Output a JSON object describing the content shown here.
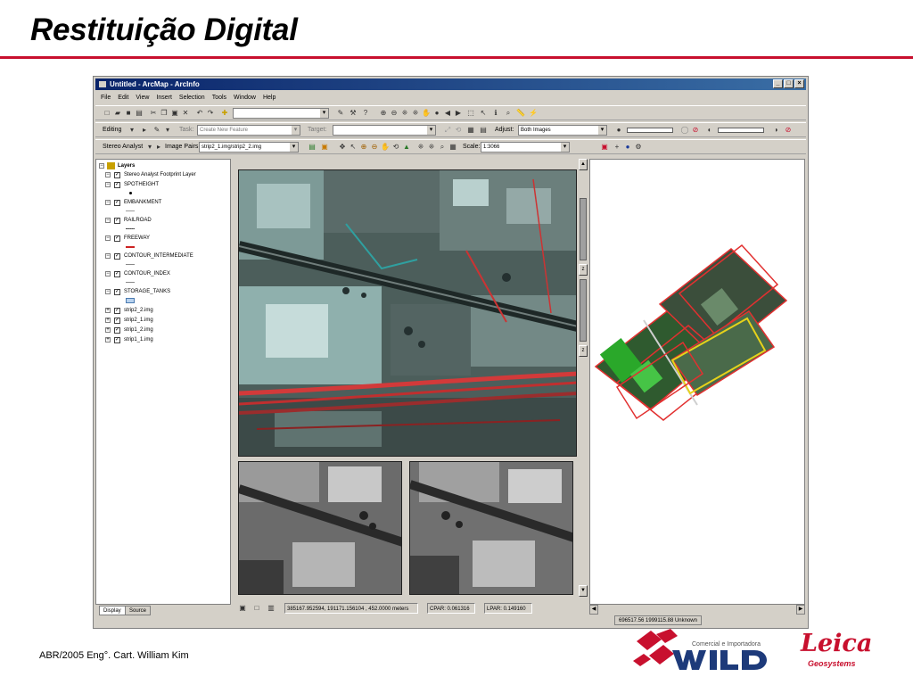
{
  "slide": {
    "title": "Restituição Digital",
    "footer": "ABR/2005 Eng°. Cart. William Kim"
  },
  "app": {
    "window_title": "Untitled - ArcMap - ArcInfo",
    "menu": [
      "File",
      "Edit",
      "View",
      "Insert",
      "Selection",
      "Tools",
      "Window",
      "Help"
    ],
    "toolbar2": {
      "editing_label": "Editing",
      "task_label": "Task:",
      "task_value": "Create New Feature",
      "target_label": "Target:",
      "target_value": "",
      "adjust_label": "Adjust:",
      "adjust_value": "Both Images"
    },
    "toolbar3": {
      "stereo_label": "Stereo Analyst",
      "image_pairs_label": "Image Pairs:",
      "image_pairs_value": "strip2_1.img/strip2_2.img",
      "scale_label": "Scale:",
      "scale_value": "1:3066"
    },
    "toc": {
      "root": "Layers",
      "layers": [
        {
          "name": "Stereo Analyst Footprint Layer",
          "symbol": "none"
        },
        {
          "name": "SPOTHEIGHT",
          "symbol": "point",
          "color": "#000000"
        },
        {
          "name": "EMBANKMENT",
          "symbol": "line",
          "color": "#9a9a9a"
        },
        {
          "name": "RAILROAD",
          "symbol": "line",
          "color": "#6a6a6a"
        },
        {
          "name": "FREEWAY",
          "symbol": "line",
          "color": "#cc2222"
        },
        {
          "name": "CONTOUR_INTERMEDIATE",
          "symbol": "line",
          "color": "#888888"
        },
        {
          "name": "CONTOUR_INDEX",
          "symbol": "line",
          "color": "#888888"
        },
        {
          "name": "STORAGE_TANKS",
          "symbol": "polygon",
          "color": "#7fa7d8"
        },
        {
          "name": "strip2_2.img",
          "symbol": "none"
        },
        {
          "name": "strip2_1.img",
          "symbol": "none"
        },
        {
          "name": "strip1_2.img",
          "symbol": "none"
        },
        {
          "name": "strip1_1.img",
          "symbol": "none"
        }
      ],
      "tabs": [
        "Display",
        "Source"
      ]
    },
    "status": {
      "coords": "385167.952594, 191171.156104 , 452.0000 meters",
      "cpar": "CPAR: 0.061316",
      "lpar": "LPAR: 0.149160"
    },
    "overview_status": "696517.56  1999115.88 Unknown",
    "scroll_markers": [
      "z",
      "z"
    ]
  },
  "logos": {
    "wild_tagline": "Comercial e Importadora",
    "wild_name": "WILD",
    "leica_name": "Leica",
    "leica_sub": "Geosystems"
  },
  "colors": {
    "accent_red": "#c8102e",
    "titlebar_blue": "#0a246a",
    "footprint_red": "#dd2222",
    "footprint_yellow": "#e6d21a"
  }
}
